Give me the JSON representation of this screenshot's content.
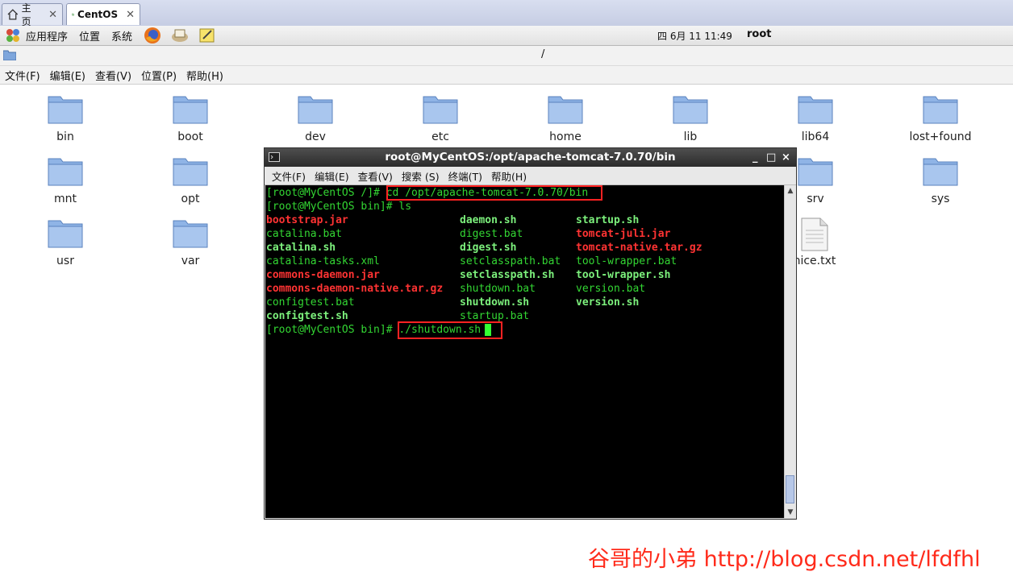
{
  "vm_tabs": [
    {
      "label": "主页",
      "icon": "home-icon"
    },
    {
      "label": "CentOS",
      "icon": "vm-icon"
    }
  ],
  "panel": {
    "menus": [
      "应用程序",
      "位置",
      "系统"
    ],
    "clock": "四 6月 11 11:49",
    "user": "root"
  },
  "file_manager": {
    "location": "/",
    "menus": [
      "文件(F)",
      "编辑(E)",
      "查看(V)",
      "位置(P)",
      "帮助(H)"
    ],
    "icons": [
      "bin",
      "boot",
      "dev",
      "etc",
      "home",
      "lib",
      "lib64",
      "lost+found",
      "mnt",
      "opt",
      "srv",
      "sys",
      "usr",
      "var",
      "nice.txt"
    ]
  },
  "terminal": {
    "title": "root@MyCentOS:/opt/apache-tomcat-7.0.70/bin",
    "window_controls": [
      "_",
      "□",
      "×"
    ],
    "menus": [
      "文件(F)",
      "编辑(E)",
      "查看(V)",
      "搜索 (S)",
      "终端(T)",
      "帮助(H)"
    ],
    "prompt1": "[root@MyCentOS /]# ",
    "cmd1": "cd /opt/apache-tomcat-7.0.70/bin",
    "prompt2": "[root@MyCentOS bin]# ",
    "cmd2": "ls",
    "files": [
      [
        "bootstrap.jar",
        "daemon.sh",
        "startup.sh"
      ],
      [
        "catalina.bat",
        "digest.bat",
        "tomcat-juli.jar"
      ],
      [
        "catalina.sh",
        "digest.sh",
        "tomcat-native.tar.gz"
      ],
      [
        "catalina-tasks.xml",
        "setclasspath.bat",
        "tool-wrapper.bat"
      ],
      [
        "commons-daemon.jar",
        "setclasspath.sh",
        "tool-wrapper.sh"
      ],
      [
        "commons-daemon-native.tar.gz",
        "shutdown.bat",
        "version.bat"
      ],
      [
        "configtest.bat",
        "shutdown.sh",
        "version.sh"
      ],
      [
        "configtest.sh",
        "startup.bat",
        ""
      ]
    ],
    "prompt3": "[root@MyCentOS bin]# ",
    "cmd3": "./shutdown.sh"
  },
  "watermark": "谷哥的小弟 http://blog.csdn.net/lfdfhl"
}
